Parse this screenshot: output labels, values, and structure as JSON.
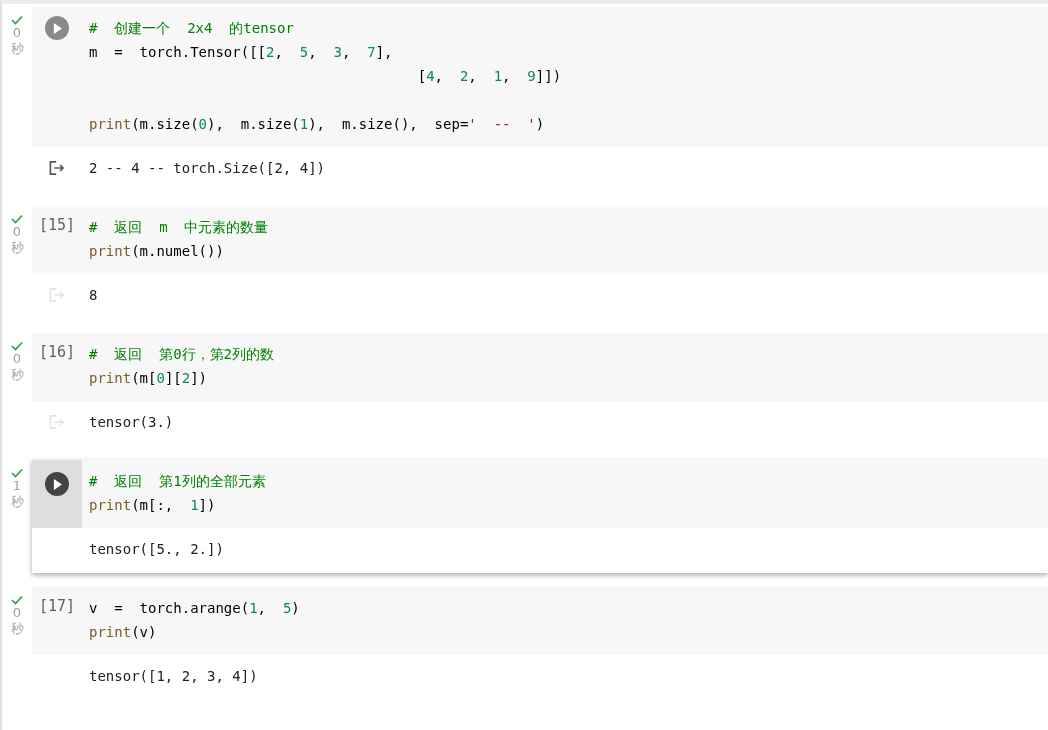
{
  "cells": [
    {
      "done": true,
      "time": "0",
      "unit": "秒",
      "hovered": true,
      "focused": false,
      "code_lines": [
        {
          "tokens": [
            {
              "kind": "comment",
              "text": "#  创建一个  2x4  的tensor"
            }
          ]
        },
        {
          "tokens": [
            {
              "kind": "name",
              "text": "m  =  torch.Tensor([["
            },
            {
              "kind": "number",
              "text": "2"
            },
            {
              "kind": "name",
              "text": ",  "
            },
            {
              "kind": "number",
              "text": "5"
            },
            {
              "kind": "name",
              "text": ",  "
            },
            {
              "kind": "number",
              "text": "3"
            },
            {
              "kind": "name",
              "text": ",  "
            },
            {
              "kind": "number",
              "text": "7"
            },
            {
              "kind": "name",
              "text": "],"
            }
          ]
        },
        {
          "tokens": [
            {
              "kind": "name",
              "text": "                                       ["
            },
            {
              "kind": "number",
              "text": "4"
            },
            {
              "kind": "name",
              "text": ",  "
            },
            {
              "kind": "number",
              "text": "2"
            },
            {
              "kind": "name",
              "text": ",  "
            },
            {
              "kind": "number",
              "text": "1"
            },
            {
              "kind": "name",
              "text": ",  "
            },
            {
              "kind": "number",
              "text": "9"
            },
            {
              "kind": "name",
              "text": "]])"
            }
          ]
        },
        {
          "gap_before": true,
          "tokens": [
            {
              "kind": "builtin",
              "text": "print"
            },
            {
              "kind": "name",
              "text": "(m.size("
            },
            {
              "kind": "number",
              "text": "0"
            },
            {
              "kind": "name",
              "text": "),  m.size("
            },
            {
              "kind": "number",
              "text": "1"
            },
            {
              "kind": "name",
              "text": "),  m.size(),  sep="
            },
            {
              "kind": "string",
              "text": "'  --  '"
            },
            {
              "kind": "name",
              "text": ")"
            }
          ]
        }
      ],
      "output": {
        "icon_shown": true,
        "lines": [
          "2 -- 4 -- torch.Size([2, 4])"
        ]
      }
    },
    {
      "done": true,
      "time": "0",
      "unit": "秒",
      "exec_count": "[15]",
      "hovered": false,
      "focused": false,
      "code_lines": [
        {
          "tokens": [
            {
              "kind": "comment",
              "text": "#  返回  m  中元素的数量"
            }
          ]
        },
        {
          "tokens": [
            {
              "kind": "builtin",
              "text": "print"
            },
            {
              "kind": "name",
              "text": "(m.numel())"
            }
          ]
        }
      ],
      "output": {
        "icon_shown": true,
        "lines": [
          "8"
        ]
      }
    },
    {
      "done": true,
      "time": "0",
      "unit": "秒",
      "exec_count": "[16]",
      "hovered": false,
      "focused": false,
      "code_lines": [
        {
          "tokens": [
            {
              "kind": "comment",
              "text": "#  返回  第0行，第2列的数"
            }
          ]
        },
        {
          "tokens": [
            {
              "kind": "builtin",
              "text": "print"
            },
            {
              "kind": "name",
              "text": "(m["
            },
            {
              "kind": "number",
              "text": "0"
            },
            {
              "kind": "name",
              "text": "]["
            },
            {
              "kind": "number",
              "text": "2"
            },
            {
              "kind": "name",
              "text": "])"
            }
          ]
        }
      ],
      "output": {
        "icon_shown": true,
        "lines": [
          "tensor(3.)"
        ]
      }
    },
    {
      "done": true,
      "time": "1",
      "unit": "秒",
      "hovered": false,
      "focused": true,
      "code_lines": [
        {
          "tokens": [
            {
              "kind": "comment",
              "text": "#  返回  第1列的全部元素"
            }
          ]
        },
        {
          "tokens": [
            {
              "kind": "builtin",
              "text": "print"
            },
            {
              "kind": "name",
              "text": "(m[:,  "
            },
            {
              "kind": "number",
              "text": "1"
            },
            {
              "kind": "name",
              "text": "])"
            }
          ]
        }
      ],
      "output": {
        "icon_shown": false,
        "lines": [
          "tensor([5., 2.])"
        ]
      }
    },
    {
      "done": true,
      "time": "0",
      "unit": "秒",
      "exec_count": "[17]",
      "hovered": false,
      "focused": false,
      "code_lines": [
        {
          "tokens": [
            {
              "kind": "name",
              "text": "v  =  torch.arange("
            },
            {
              "kind": "number",
              "text": "1"
            },
            {
              "kind": "name",
              "text": ",  "
            },
            {
              "kind": "number",
              "text": "5"
            },
            {
              "kind": "name",
              "text": ")"
            }
          ]
        },
        {
          "tokens": [
            {
              "kind": "builtin",
              "text": "print"
            },
            {
              "kind": "name",
              "text": "(v)"
            }
          ]
        }
      ],
      "output": {
        "icon_shown": false,
        "lines": [
          "tensor([1, 2, 3, 4])"
        ]
      }
    }
  ]
}
